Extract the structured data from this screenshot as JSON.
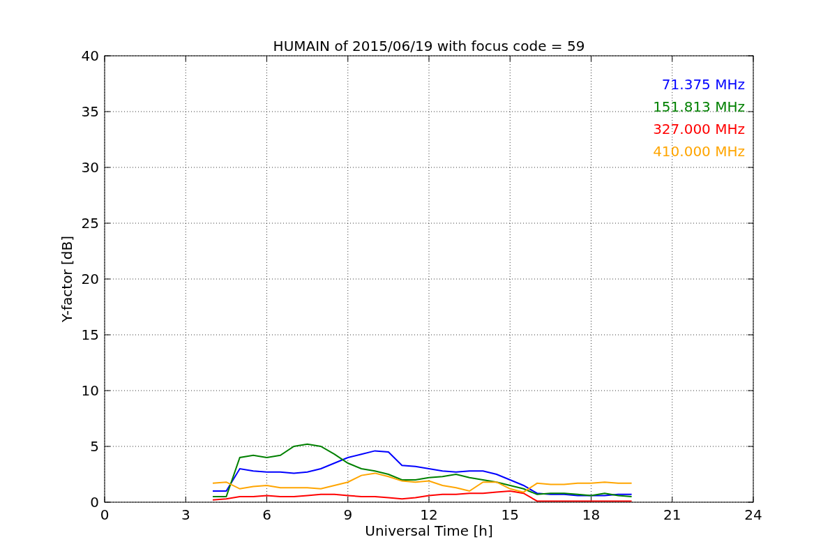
{
  "chart_data": {
    "type": "line",
    "title": "HUMAIN of 2015/06/19 with focus code = 59",
    "xlabel": "Universal Time [h]",
    "ylabel": "Y-factor [dB]",
    "x": [
      4,
      4.5,
      5,
      5.5,
      6,
      6.5,
      7,
      7.5,
      8,
      8.5,
      9,
      9.5,
      10,
      10.5,
      11,
      11.5,
      12,
      12.5,
      13,
      13.5,
      14,
      14.5,
      15,
      15.5,
      16,
      16.5,
      17,
      17.5,
      18,
      18.5,
      19,
      19.5
    ],
    "series": [
      {
        "name": "71.375 MHz",
        "color": "#0000ff",
        "values": [
          1,
          1,
          3,
          2.8,
          2.7,
          2.7,
          2.6,
          2.7,
          3,
          3.5,
          4,
          4.3,
          4.6,
          4.5,
          3.3,
          3.2,
          3,
          2.8,
          2.7,
          2.8,
          2.8,
          2.5,
          2,
          1.5,
          0.8,
          0.7,
          0.7,
          0.6,
          0.6,
          0.6,
          0.7,
          0.7
        ]
      },
      {
        "name": "151.813 MHz",
        "color": "#008000",
        "values": [
          0.5,
          0.5,
          4,
          4.2,
          4,
          4.2,
          5,
          5.2,
          5,
          4.3,
          3.5,
          3,
          2.8,
          2.5,
          2,
          2,
          2.2,
          2.3,
          2.5,
          2.2,
          2,
          1.8,
          1.5,
          1.2,
          0.7,
          0.8,
          0.8,
          0.7,
          0.6,
          0.8,
          0.6,
          0.5
        ]
      },
      {
        "name": "327.000 MHz",
        "color": "#ff0000",
        "values": [
          0.2,
          0.3,
          0.5,
          0.5,
          0.6,
          0.5,
          0.5,
          0.6,
          0.7,
          0.7,
          0.6,
          0.5,
          0.5,
          0.4,
          0.3,
          0.4,
          0.6,
          0.7,
          0.7,
          0.8,
          0.8,
          0.9,
          1,
          0.8,
          0.1,
          0.1,
          0.1,
          0.1,
          0.1,
          0.1,
          0.1,
          0.1
        ]
      },
      {
        "name": "410.000 MHz",
        "color": "#ffa500",
        "values": [
          1.7,
          1.8,
          1.2,
          1.4,
          1.5,
          1.3,
          1.3,
          1.3,
          1.2,
          1.5,
          1.8,
          2.4,
          2.6,
          2.3,
          1.9,
          1.8,
          1.9,
          1.5,
          1.3,
          1,
          1.8,
          1.8,
          1.2,
          0.9,
          1.7,
          1.6,
          1.6,
          1.7,
          1.7,
          1.8,
          1.7,
          1.7
        ]
      }
    ],
    "xlim": [
      0,
      24
    ],
    "ylim": [
      0,
      40
    ],
    "xticks": [
      0,
      3,
      6,
      9,
      12,
      15,
      18,
      21,
      24
    ],
    "yticks": [
      0,
      5,
      10,
      15,
      20,
      25,
      30,
      35,
      40
    ],
    "grid": true
  }
}
